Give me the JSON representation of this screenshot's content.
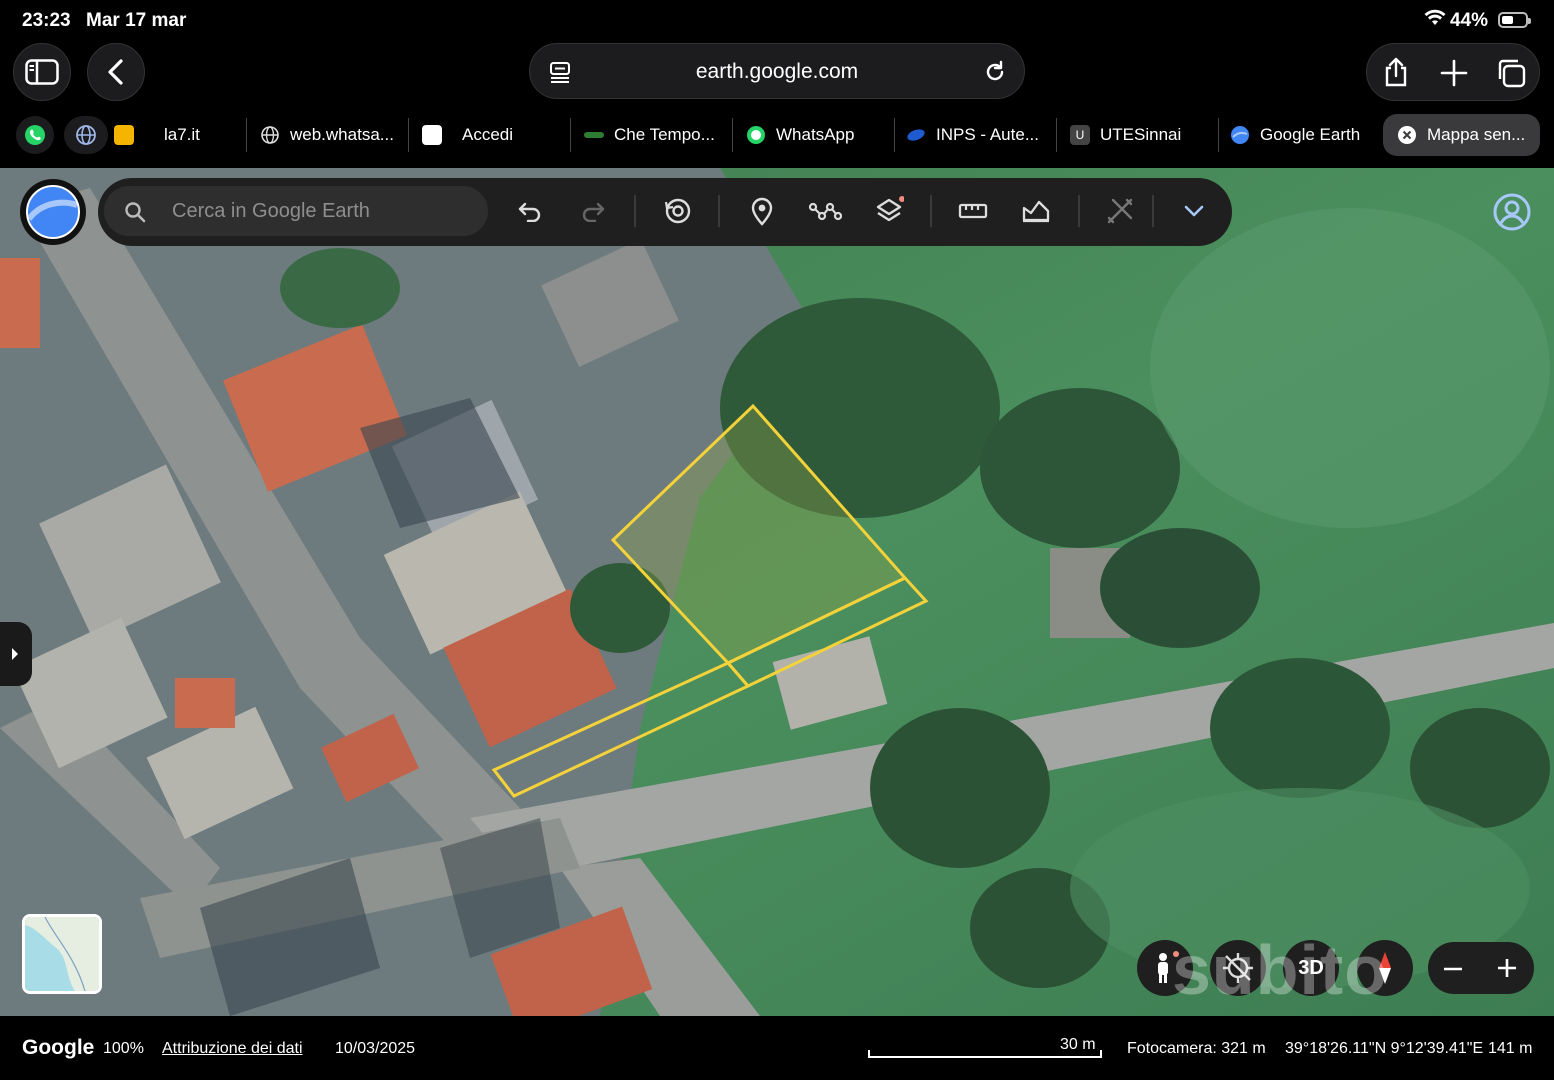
{
  "status_bar": {
    "time": "23:23",
    "date": "Mar 17 mar",
    "battery": "44%"
  },
  "browser": {
    "url": "earth.google.com"
  },
  "tabs": [
    {
      "label": "la7.it",
      "favicon_color": "#f4b400"
    },
    {
      "label": "web.whatsa...",
      "favicon_color": "#9aa0a6"
    },
    {
      "label": "Accedi",
      "favicon_color": "#ffffff"
    },
    {
      "label": "Che Tempo...",
      "favicon_color": "#2e7d32"
    },
    {
      "label": "WhatsApp",
      "favicon_color": "#25d366"
    },
    {
      "label": "INPS - Aute...",
      "favicon_color": "#1e5bd0"
    },
    {
      "label": "UTESinnai",
      "favicon_color": "#444444"
    },
    {
      "label": "Google Earth",
      "favicon_color": "#4285f4"
    },
    {
      "label": "Mappa sen...",
      "favicon_color": "#ffffff"
    }
  ],
  "earth": {
    "search_placeholder": "Cerca in Google Earth",
    "mode_3d": "3D",
    "parcel_color": "#f3d23a"
  },
  "footer": {
    "logo": "Google",
    "zoom": "100%",
    "attribution": "Attribuzione dei dati",
    "date": "10/03/2025",
    "scale": "30 m",
    "camera": "Fotocamera: 321 m",
    "coords": "39°18'26.11\"N 9°12'39.41\"E",
    "altitude": "141 m"
  },
  "watermark": "subito"
}
